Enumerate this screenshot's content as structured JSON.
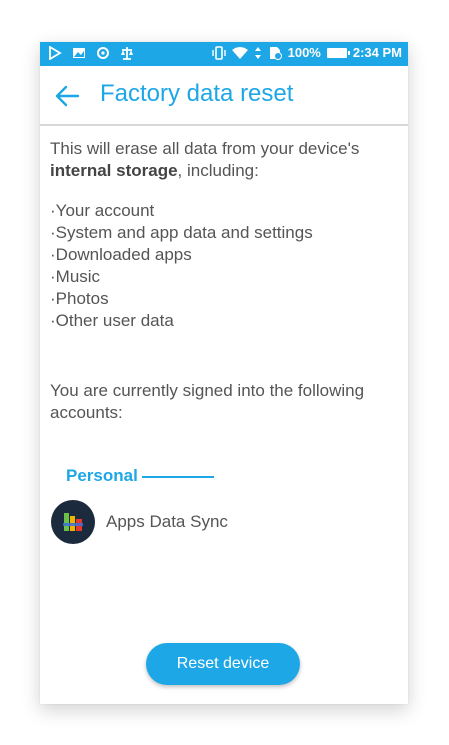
{
  "status_bar": {
    "battery": "100%",
    "time": "2:34 PM",
    "left_icons": [
      "play-store-icon",
      "image-icon",
      "sync-icon",
      "scale-icon"
    ],
    "right_icons": [
      "vibrate-icon",
      "wifi-icon",
      "data-arrows-icon",
      "sim-icon",
      "battery-icon"
    ]
  },
  "app_bar": {
    "title": "Factory data reset",
    "back_icon": "back-arrow-icon"
  },
  "intro": {
    "text_before": "This will erase all data from your device's ",
    "bold": "internal storage",
    "text_after": ", including:"
  },
  "erase_list": [
    "·Your account",
    "·System and app data and settings",
    "·Downloaded apps",
    "·Music",
    "·Photos",
    "·Other user data"
  ],
  "signed_in_text": "You are currently signed into the following accounts:",
  "section": {
    "label": "Personal"
  },
  "account": {
    "name": "Apps Data Sync",
    "icon": "apps-data-sync-avatar-icon"
  },
  "reset_button": {
    "label": "Reset device"
  },
  "colors": {
    "accent": "#1ea7e6",
    "text": "#555555"
  }
}
